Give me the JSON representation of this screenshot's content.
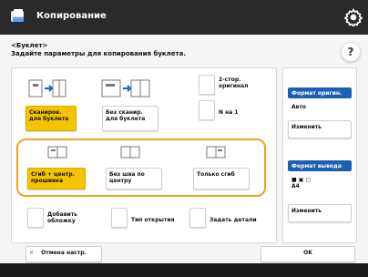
{
  "title": "Копирование",
  "header": {
    "title": "<Буклет>",
    "subtitle": "Задайте параметры для копирования буклета."
  },
  "options": {
    "scan_booklet": "Сканиров. для буклета",
    "no_scan_booklet": "Без сканир. для буклета",
    "two_sided_original": "2-стор. оригинал",
    "n_on_1": "N на 1",
    "saddle_center_fold": "Сгиб + центр. прошивка",
    "saddle_stitch": "Без шва по центру",
    "fold_only": "Только сгиб",
    "add_cover": "Добавить обложку",
    "open_type": "Тип открытия",
    "trim": "Задать детали"
  },
  "side": {
    "paper_format_header": "Формат оригин.",
    "paper_format_value": "Авто",
    "change1": "Изменить",
    "finish_format_header": "Формат вывода",
    "finish_format_value": "■ ▣ ▢\nA4",
    "change2": "Изменить"
  },
  "footer": {
    "cancel": "Отмена настр.",
    "ok": "OK"
  },
  "colors": {
    "selected": "#f5c400",
    "orange_outline": "#f2a31b",
    "side_header": "#1d5fb3"
  }
}
